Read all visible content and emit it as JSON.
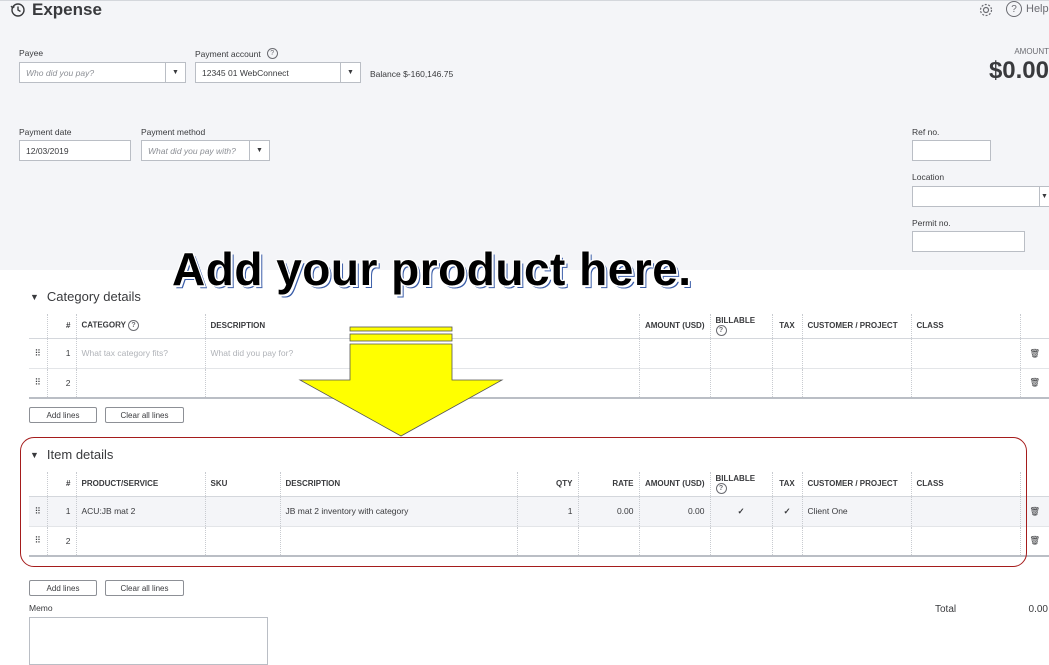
{
  "header": {
    "title": "Expense",
    "help_label": "Help"
  },
  "form": {
    "payee_label": "Payee",
    "payee_placeholder": "Who did you pay?",
    "payment_account_label": "Payment account",
    "payment_account_value": "12345 01 WebConnect",
    "balance_text": "Balance $-160,146.75",
    "amount_label": "AMOUNT",
    "amount_value": "$0.00",
    "payment_date_label": "Payment date",
    "payment_date_value": "12/03/2019",
    "payment_method_label": "Payment method",
    "payment_method_placeholder": "What did you pay with?",
    "ref_no_label": "Ref no.",
    "location_label": "Location",
    "permit_no_label": "Permit no."
  },
  "overlay": {
    "text": "Add your product here.",
    "arrow_color": "#ffff00",
    "highlight_color": "#a51c1c"
  },
  "category_details": {
    "title": "Category details",
    "columns": [
      "#",
      "CATEGORY",
      "DESCRIPTION",
      "AMOUNT (USD)",
      "BILLABLE",
      "TAX",
      "CUSTOMER / PROJECT",
      "CLASS"
    ],
    "rows": [
      {
        "num": "1",
        "category": "What tax category fits?",
        "description": "What did you pay for?"
      },
      {
        "num": "2",
        "category": "",
        "description": ""
      }
    ],
    "add_lines_label": "Add lines",
    "clear_lines_label": "Clear all lines"
  },
  "item_details": {
    "title": "Item details",
    "columns": [
      "#",
      "PRODUCT/SERVICE",
      "SKU",
      "DESCRIPTION",
      "QTY",
      "RATE",
      "AMOUNT (USD)",
      "BILLABLE",
      "TAX",
      "CUSTOMER / PROJECT",
      "CLASS"
    ],
    "rows": [
      {
        "num": "1",
        "product": "ACU:JB mat 2",
        "sku": "",
        "description": "JB mat 2 inventory with category",
        "qty": "1",
        "rate": "0.00",
        "amount": "0.00",
        "billable": "✓",
        "tax": "✓",
        "customer": "Client One",
        "class": ""
      },
      {
        "num": "2",
        "product": "",
        "sku": "",
        "description": "",
        "qty": "",
        "rate": "",
        "amount": "",
        "billable": "",
        "tax": "",
        "customer": "",
        "class": ""
      }
    ],
    "add_lines_label": "Add lines",
    "clear_lines_label": "Clear all lines"
  },
  "footer": {
    "memo_label": "Memo",
    "total_label": "Total",
    "total_value": "0.00"
  },
  "colors": {
    "brand_check": "#2ca01c",
    "background_top": "#f4f5f8"
  }
}
